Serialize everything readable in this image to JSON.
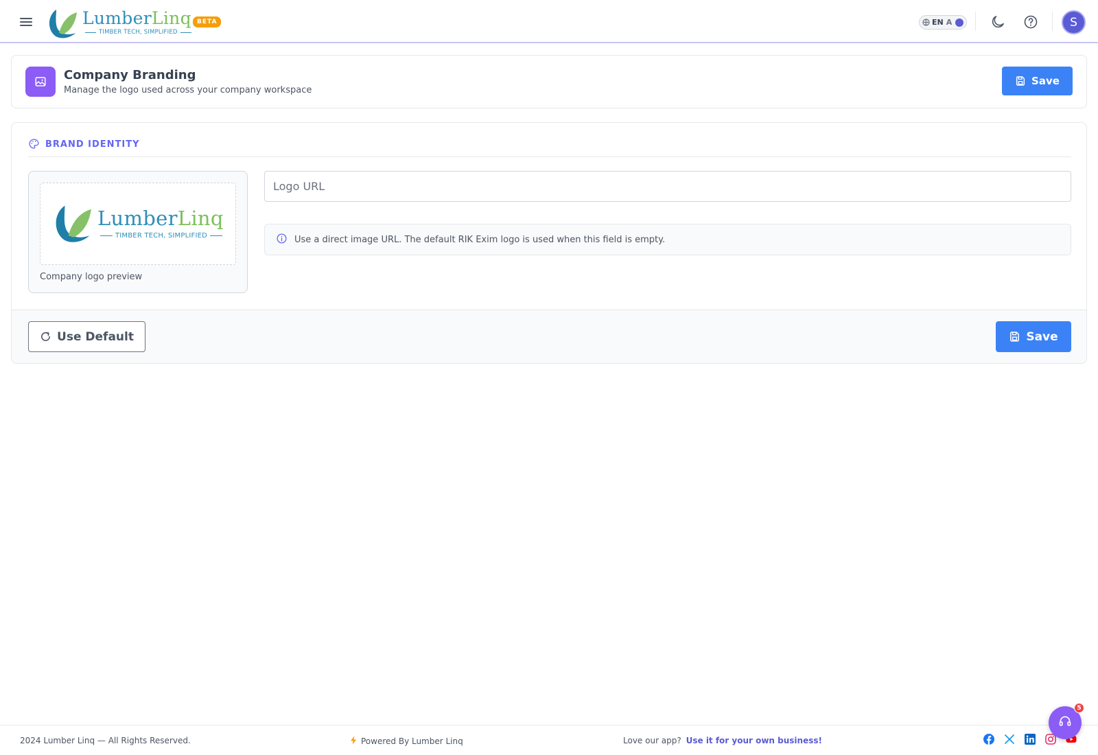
{
  "header": {
    "brand_word_1": "Lumber",
    "brand_word_2": "Linq",
    "brand_tagline": "TIMBER TECH, SIMPLIFIED",
    "beta_label": "BETA",
    "lang_label": "EN",
    "lang_alt": "A",
    "avatar_initial": "S"
  },
  "page": {
    "title": "Company Branding",
    "subtitle": "Manage the logo used across your company workspace",
    "save_label": "Save"
  },
  "brand_identity": {
    "section_title": "BRAND IDENTITY",
    "preview_brand_word_1": "Lumber",
    "preview_brand_word_2": "Linq",
    "preview_tagline": "TIMBER TECH, SIMPLIFIED",
    "preview_caption": "Company logo preview",
    "logo_url_placeholder": "Logo URL",
    "logo_url_value": "",
    "info_text": "Use a direct image URL. The default RIK Exim logo is used when this field is empty.",
    "use_default_label": "Use Default",
    "save_label": "Save"
  },
  "footer": {
    "copyright": "2024 Lumber Linq — All Rights Reserved.",
    "powered": "Powered By Lumber Linq",
    "love_prefix": "Love our app?",
    "love_link": "Use it for your own business!",
    "socials": [
      "facebook-icon",
      "x-icon",
      "linkedin-icon",
      "instagram-icon",
      "youtube-icon"
    ]
  },
  "support": {
    "badge_count": "5"
  },
  "colors": {
    "primary": "#3b82f6",
    "accent": "#8b5cf6",
    "indigo": "#6366f1",
    "beta": "#f59e0b",
    "brand_blue": "#2e8fb8",
    "brand_green": "#7bbf5a"
  }
}
